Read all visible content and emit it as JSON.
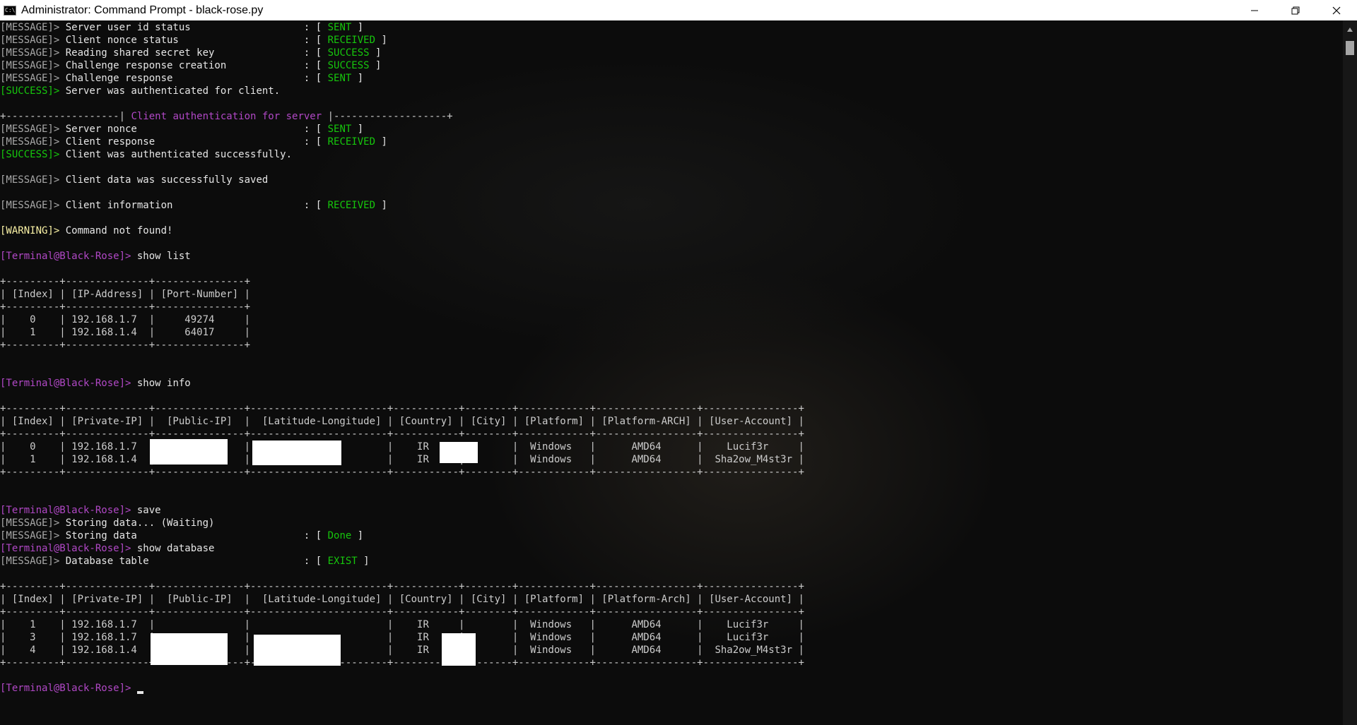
{
  "window": {
    "title": "Administrator: Command Prompt - black-rose.py",
    "app_icon_text": "C:\\"
  },
  "colors": {
    "background": "#0c0c0c",
    "tag": "#a8a8a8",
    "text": "#e6e6e6",
    "status_ok": "#16c60c",
    "prompt": "#b148c6",
    "warning": "#f9f1a5"
  },
  "icons": {
    "minimize": "minimize-icon",
    "maximize": "restore-icon",
    "close": "close-icon",
    "scroll_up": "chevron-up-icon"
  },
  "console_lines": [
    [
      [
        "gray",
        "[MESSAGE]> "
      ],
      [
        "white",
        "Server user id status                   : "
      ],
      [
        "white",
        "[ "
      ],
      [
        "green",
        "SENT"
      ],
      [
        "white",
        " ]"
      ]
    ],
    [
      [
        "gray",
        "[MESSAGE]> "
      ],
      [
        "white",
        "Client nonce status                     : "
      ],
      [
        "white",
        "[ "
      ],
      [
        "green",
        "RECEIVED"
      ],
      [
        "white",
        " ]"
      ]
    ],
    [
      [
        "gray",
        "[MESSAGE]> "
      ],
      [
        "white",
        "Reading shared secret key               : "
      ],
      [
        "white",
        "[ "
      ],
      [
        "green",
        "SUCCESS"
      ],
      [
        "white",
        " ]"
      ]
    ],
    [
      [
        "gray",
        "[MESSAGE]> "
      ],
      [
        "white",
        "Challenge response creation             : "
      ],
      [
        "white",
        "[ "
      ],
      [
        "green",
        "SUCCESS"
      ],
      [
        "white",
        " ]"
      ]
    ],
    [
      [
        "gray",
        "[MESSAGE]> "
      ],
      [
        "white",
        "Challenge response                      : "
      ],
      [
        "white",
        "[ "
      ],
      [
        "green",
        "SENT"
      ],
      [
        "white",
        " ]"
      ]
    ],
    [
      [
        "green",
        "[SUCCESS]> "
      ],
      [
        "white",
        "Server was authenticated for client."
      ]
    ],
    [],
    [
      [
        "dim",
        "+-------------------| "
      ],
      [
        "purple",
        "Client authentication for server"
      ],
      [
        "dim",
        " |-------------------+"
      ]
    ],
    [
      [
        "gray",
        "[MESSAGE]> "
      ],
      [
        "white",
        "Server nonce                            : "
      ],
      [
        "white",
        "[ "
      ],
      [
        "green",
        "SENT"
      ],
      [
        "white",
        " ]"
      ]
    ],
    [
      [
        "gray",
        "[MESSAGE]> "
      ],
      [
        "white",
        "Client response                         : "
      ],
      [
        "white",
        "[ "
      ],
      [
        "green",
        "RECEIVED"
      ],
      [
        "white",
        " ]"
      ]
    ],
    [
      [
        "green",
        "[SUCCESS]> "
      ],
      [
        "white",
        "Client was authenticated successfully."
      ]
    ],
    [],
    [
      [
        "gray",
        "[MESSAGE]> "
      ],
      [
        "white",
        "Client data was successfully saved"
      ]
    ],
    [],
    [
      [
        "gray",
        "[MESSAGE]> "
      ],
      [
        "white",
        "Client information                      : "
      ],
      [
        "white",
        "[ "
      ],
      [
        "green",
        "RECEIVED"
      ],
      [
        "white",
        " ]"
      ]
    ],
    [],
    [
      [
        "yellow",
        "[WARNING]> "
      ],
      [
        "white",
        "Command not found!"
      ]
    ],
    [],
    [
      [
        "purple",
        "[Terminal@Black-Rose]> "
      ],
      [
        "white",
        "show list"
      ]
    ],
    [],
    [
      [
        "dim",
        "+---------+--------------+---------------+"
      ]
    ],
    [
      [
        "dim",
        "| [Index] | [IP-Address] | [Port-Number] |"
      ]
    ],
    [
      [
        "dim",
        "+---------+--------------+---------------+"
      ]
    ],
    [
      [
        "dim",
        "|    0    | 192.168.1.7  |     49274     |"
      ]
    ],
    [
      [
        "dim",
        "|    1    | 192.168.1.4  |     64017     |"
      ]
    ],
    [
      [
        "dim",
        "+---------+--------------+---------------+"
      ]
    ],
    [],
    [],
    [
      [
        "purple",
        "[Terminal@Black-Rose]> "
      ],
      [
        "white",
        "show info"
      ]
    ],
    [],
    [
      [
        "dim",
        "+---------+--------------+---------------+-----------------------+-----------+--------+------------+-----------------+----------------+"
      ]
    ],
    [
      [
        "dim",
        "| [Index] | [Private-IP] |  [Public-IP]  |  [Latitude-Longitude] | [Country] | [City] | [Platform] | [Platform-ARCH] | [User-Account] |"
      ]
    ],
    [
      [
        "dim",
        "+---------+--------------+---------------+-----------------------+-----------+--------+------------+-----------------+----------------+"
      ]
    ],
    [
      [
        "dim",
        "|    0    | 192.168.1.7  |               |                       |    IR     |        |  Windows   |      AMD64      |    Lucif3r     |"
      ]
    ],
    [
      [
        "dim",
        "|    1    | 192.168.1.4  |               |                       |    IR     |        |  Windows   |      AMD64      |  Sha2ow_M4st3r |"
      ]
    ],
    [
      [
        "dim",
        "+---------+--------------+---------------+-----------------------+-----------+--------+------------+-----------------+----------------+"
      ]
    ],
    [],
    [],
    [
      [
        "purple",
        "[Terminal@Black-Rose]> "
      ],
      [
        "white",
        "save"
      ]
    ],
    [
      [
        "gray",
        "[MESSAGE]> "
      ],
      [
        "white",
        "Storing data... (Waiting)"
      ]
    ],
    [
      [
        "gray",
        "[MESSAGE]> "
      ],
      [
        "white",
        "Storing data                            : "
      ],
      [
        "white",
        "[ "
      ],
      [
        "green",
        "Done"
      ],
      [
        "white",
        " ]"
      ]
    ],
    [
      [
        "purple",
        "[Terminal@Black-Rose]> "
      ],
      [
        "white",
        "show database"
      ]
    ],
    [
      [
        "gray",
        "[MESSAGE]> "
      ],
      [
        "white",
        "Database table                          : "
      ],
      [
        "white",
        "[ "
      ],
      [
        "green",
        "EXIST"
      ],
      [
        "white",
        " ]"
      ]
    ],
    [],
    [
      [
        "dim",
        "+---------+--------------+---------------+-----------------------+-----------+--------+------------+-----------------+----------------+"
      ]
    ],
    [
      [
        "dim",
        "| [Index] | [Private-IP] |  [Public-IP]  |  [Latitude-Longitude] | [Country] | [City] | [Platform] | [Platform-Arch] | [User-Account] |"
      ]
    ],
    [
      [
        "dim",
        "+---------+--------------+---------------+-----------------------+-----------+--------+------------+-----------------+----------------+"
      ]
    ],
    [
      [
        "dim",
        "|    1    | 192.168.1.7  |               |                       |    IR     |        |  Windows   |      AMD64      |    Lucif3r     |"
      ]
    ],
    [
      [
        "dim",
        "|    3    | 192.168.1.7  |               |                       |    IR     |        |  Windows   |      AMD64      |    Lucif3r     |"
      ]
    ],
    [
      [
        "dim",
        "|    4    | 192.168.1.4  |               |                       |    IR     |        |  Windows   |      AMD64      |  Sha2ow_M4st3r |"
      ]
    ],
    [
      [
        "dim",
        "+---------+--------------+---------------+-----------------------+-----------+--------+------------+-----------------+----------------+"
      ]
    ],
    [],
    [
      [
        "purple",
        "[Terminal@Black-Rose]> "
      ]
    ]
  ]
}
